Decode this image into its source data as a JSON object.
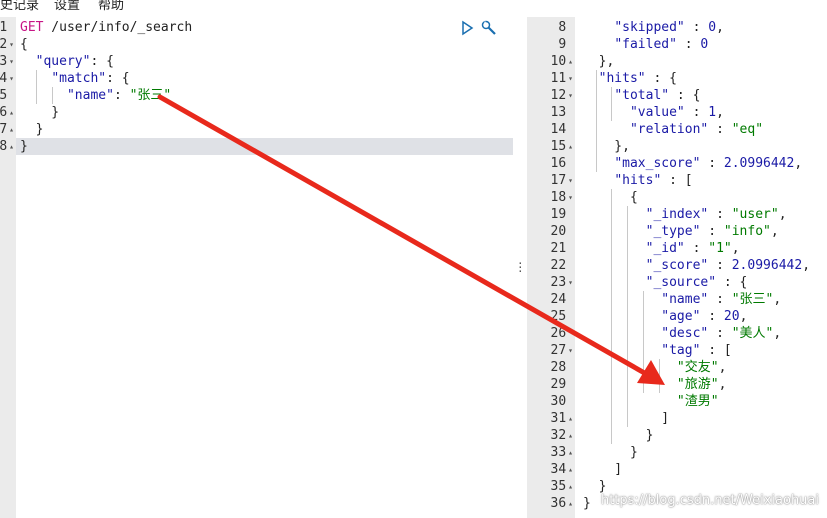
{
  "menu": {
    "history": "史记录",
    "settings": "设置",
    "help": "帮助"
  },
  "request": {
    "method": "GET",
    "path": "/user/info/_search",
    "lines": [
      {
        "n": "1",
        "fold": "",
        "parts": [
          [
            "m",
            "GET"
          ],
          [
            "p",
            " /user/info/_search"
          ]
        ]
      },
      {
        "n": "2",
        "fold": "▾",
        "parts": [
          [
            "p",
            "{"
          ]
        ]
      },
      {
        "n": "3",
        "fold": "▾",
        "parts": [
          [
            "p",
            "  "
          ],
          [
            "k",
            "\"query\""
          ],
          [
            "p",
            ": {"
          ]
        ]
      },
      {
        "n": "4",
        "fold": "▾",
        "parts": [
          [
            "p",
            "    "
          ],
          [
            "k",
            "\"match\""
          ],
          [
            "p",
            ": {"
          ]
        ]
      },
      {
        "n": "5",
        "fold": "",
        "parts": [
          [
            "p",
            "      "
          ],
          [
            "k",
            "\"name\""
          ],
          [
            "p",
            ": "
          ],
          [
            "s",
            "\"张三\""
          ]
        ]
      },
      {
        "n": "6",
        "fold": "▴",
        "parts": [
          [
            "p",
            "    }"
          ]
        ]
      },
      {
        "n": "7",
        "fold": "▴",
        "parts": [
          [
            "p",
            "  }"
          ]
        ]
      },
      {
        "n": "8",
        "fold": "▴",
        "parts": [
          [
            "p",
            "}"
          ]
        ]
      }
    ]
  },
  "response": {
    "lines": [
      {
        "n": "8",
        "fold": "",
        "parts": [
          [
            "p",
            "    "
          ],
          [
            "k",
            "\"skipped\""
          ],
          [
            "p",
            " : "
          ],
          [
            "n",
            "0"
          ],
          [
            "p",
            ","
          ]
        ]
      },
      {
        "n": "9",
        "fold": "",
        "parts": [
          [
            "p",
            "    "
          ],
          [
            "k",
            "\"failed\""
          ],
          [
            "p",
            " : "
          ],
          [
            "n",
            "0"
          ]
        ]
      },
      {
        "n": "10",
        "fold": "▴",
        "parts": [
          [
            "p",
            "  },"
          ]
        ]
      },
      {
        "n": "11",
        "fold": "▾",
        "parts": [
          [
            "p",
            "  "
          ],
          [
            "k",
            "\"hits\""
          ],
          [
            "p",
            " : {"
          ]
        ]
      },
      {
        "n": "12",
        "fold": "▾",
        "parts": [
          [
            "p",
            "    "
          ],
          [
            "k",
            "\"total\""
          ],
          [
            "p",
            " : {"
          ]
        ]
      },
      {
        "n": "13",
        "fold": "",
        "parts": [
          [
            "p",
            "      "
          ],
          [
            "k",
            "\"value\""
          ],
          [
            "p",
            " : "
          ],
          [
            "n",
            "1"
          ],
          [
            "p",
            ","
          ]
        ]
      },
      {
        "n": "14",
        "fold": "",
        "parts": [
          [
            "p",
            "      "
          ],
          [
            "k",
            "\"relation\""
          ],
          [
            "p",
            " : "
          ],
          [
            "s",
            "\"eq\""
          ]
        ]
      },
      {
        "n": "15",
        "fold": "▴",
        "parts": [
          [
            "p",
            "    },"
          ]
        ]
      },
      {
        "n": "16",
        "fold": "",
        "parts": [
          [
            "p",
            "    "
          ],
          [
            "k",
            "\"max_score\""
          ],
          [
            "p",
            " : "
          ],
          [
            "n",
            "2.0996442"
          ],
          [
            "p",
            ","
          ]
        ]
      },
      {
        "n": "17",
        "fold": "▾",
        "parts": [
          [
            "p",
            "    "
          ],
          [
            "k",
            "\"hits\""
          ],
          [
            "p",
            " : ["
          ]
        ]
      },
      {
        "n": "18",
        "fold": "▾",
        "parts": [
          [
            "p",
            "      {"
          ]
        ]
      },
      {
        "n": "19",
        "fold": "",
        "parts": [
          [
            "p",
            "        "
          ],
          [
            "k",
            "\"_index\""
          ],
          [
            "p",
            " : "
          ],
          [
            "s",
            "\"user\""
          ],
          [
            "p",
            ","
          ]
        ]
      },
      {
        "n": "20",
        "fold": "",
        "parts": [
          [
            "p",
            "        "
          ],
          [
            "k",
            "\"_type\""
          ],
          [
            "p",
            " : "
          ],
          [
            "s",
            "\"info\""
          ],
          [
            "p",
            ","
          ]
        ]
      },
      {
        "n": "21",
        "fold": "",
        "parts": [
          [
            "p",
            "        "
          ],
          [
            "k",
            "\"_id\""
          ],
          [
            "p",
            " : "
          ],
          [
            "s",
            "\"1\""
          ],
          [
            "p",
            ","
          ]
        ]
      },
      {
        "n": "22",
        "fold": "",
        "parts": [
          [
            "p",
            "        "
          ],
          [
            "k",
            "\"_score\""
          ],
          [
            "p",
            " : "
          ],
          [
            "n",
            "2.0996442"
          ],
          [
            "p",
            ","
          ]
        ]
      },
      {
        "n": "23",
        "fold": "▾",
        "parts": [
          [
            "p",
            "        "
          ],
          [
            "k",
            "\"_source\""
          ],
          [
            "p",
            " : {"
          ]
        ]
      },
      {
        "n": "24",
        "fold": "",
        "parts": [
          [
            "p",
            "          "
          ],
          [
            "k",
            "\"name\""
          ],
          [
            "p",
            " : "
          ],
          [
            "s",
            "\"张三\""
          ],
          [
            "p",
            ","
          ]
        ]
      },
      {
        "n": "25",
        "fold": "",
        "parts": [
          [
            "p",
            "          "
          ],
          [
            "k",
            "\"age\""
          ],
          [
            "p",
            " : "
          ],
          [
            "n",
            "20"
          ],
          [
            "p",
            ","
          ]
        ]
      },
      {
        "n": "26",
        "fold": "",
        "parts": [
          [
            "p",
            "          "
          ],
          [
            "k",
            "\"desc\""
          ],
          [
            "p",
            " : "
          ],
          [
            "s",
            "\"美人\""
          ],
          [
            "p",
            ","
          ]
        ]
      },
      {
        "n": "27",
        "fold": "▾",
        "parts": [
          [
            "p",
            "          "
          ],
          [
            "k",
            "\"tag\""
          ],
          [
            "p",
            " : ["
          ]
        ]
      },
      {
        "n": "28",
        "fold": "",
        "parts": [
          [
            "p",
            "            "
          ],
          [
            "s",
            "\"交友\""
          ],
          [
            "p",
            ","
          ]
        ]
      },
      {
        "n": "29",
        "fold": "",
        "parts": [
          [
            "p",
            "            "
          ],
          [
            "s",
            "\"旅游\""
          ],
          [
            "p",
            ","
          ]
        ]
      },
      {
        "n": "30",
        "fold": "",
        "parts": [
          [
            "p",
            "            "
          ],
          [
            "s",
            "\"渣男\""
          ]
        ]
      },
      {
        "n": "31",
        "fold": "▴",
        "parts": [
          [
            "p",
            "          ]"
          ]
        ]
      },
      {
        "n": "32",
        "fold": "▴",
        "parts": [
          [
            "p",
            "        }"
          ]
        ]
      },
      {
        "n": "33",
        "fold": "▴",
        "parts": [
          [
            "p",
            "      }"
          ]
        ]
      },
      {
        "n": "34",
        "fold": "▴",
        "parts": [
          [
            "p",
            "    ]"
          ]
        ]
      },
      {
        "n": "35",
        "fold": "▴",
        "parts": [
          [
            "p",
            "  }"
          ]
        ]
      },
      {
        "n": "36",
        "fold": "▴",
        "parts": [
          [
            "p",
            "}"
          ]
        ]
      }
    ]
  },
  "icons": {
    "run": "play-icon",
    "settings": "wrench-icon",
    "splitter": "vertical-dots-icon"
  },
  "annotation": {
    "color": "#e8291c"
  },
  "watermark": "https://blog.csdn.net/Weixiaohuai"
}
